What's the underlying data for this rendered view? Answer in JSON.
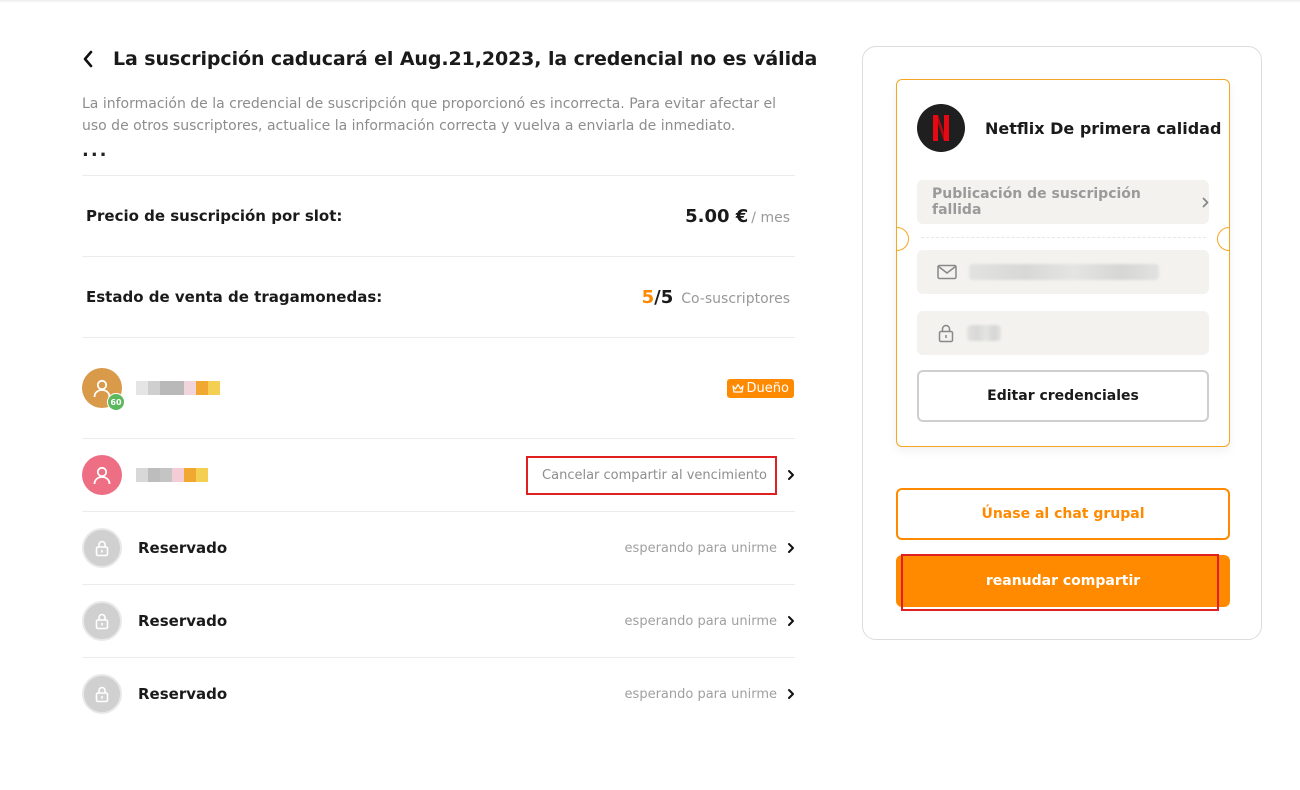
{
  "page": {
    "title": "La suscripción caducará el Aug.21,2023, la credencial no es válida",
    "description": "La información de la credencial de suscripción que proporcionó es incorrecta. Para evitar afectar el uso de otros suscriptores, actualice la información correcta y vuelva a enviarla de inmediato.",
    "more": "..."
  },
  "price": {
    "label": "Precio de suscripción por slot:",
    "value": "5.00 €",
    "unit": "/ mes"
  },
  "slots": {
    "label": "Estado de venta de tragamonedas:",
    "sold": "5",
    "separator": "/",
    "total": "5",
    "suffix": "Co-suscriptores"
  },
  "members": [
    {
      "avatar_icon": "user-icon",
      "level": "60",
      "badge": "Dueño",
      "badge_icon": "crown-icon"
    },
    {
      "avatar_icon": "user-icon",
      "status": "Cancelar compartir al vencimiento"
    },
    {
      "name": "Reservado",
      "status": "esperando para unirme",
      "avatar_icon": "lock-icon"
    },
    {
      "name": "Reservado",
      "status": "esperando para unirme",
      "avatar_icon": "lock-icon"
    },
    {
      "name": "Reservado",
      "status": "esperando para unirme",
      "avatar_icon": "lock-icon"
    }
  ],
  "card": {
    "service_name": "Netflix De primera calidad",
    "service_logo_letter": "N",
    "status": "Publicación de suscripción fallida",
    "email_icon": "mail-icon",
    "password_icon": "lock-icon",
    "edit_button": "Editar credenciales",
    "join_button": "Únase al chat grupal",
    "resume_button": "reanudar compartir"
  },
  "colors": {
    "accent": "#ff8a00",
    "highlight": "#e02020",
    "netflix_red": "#e50914"
  }
}
